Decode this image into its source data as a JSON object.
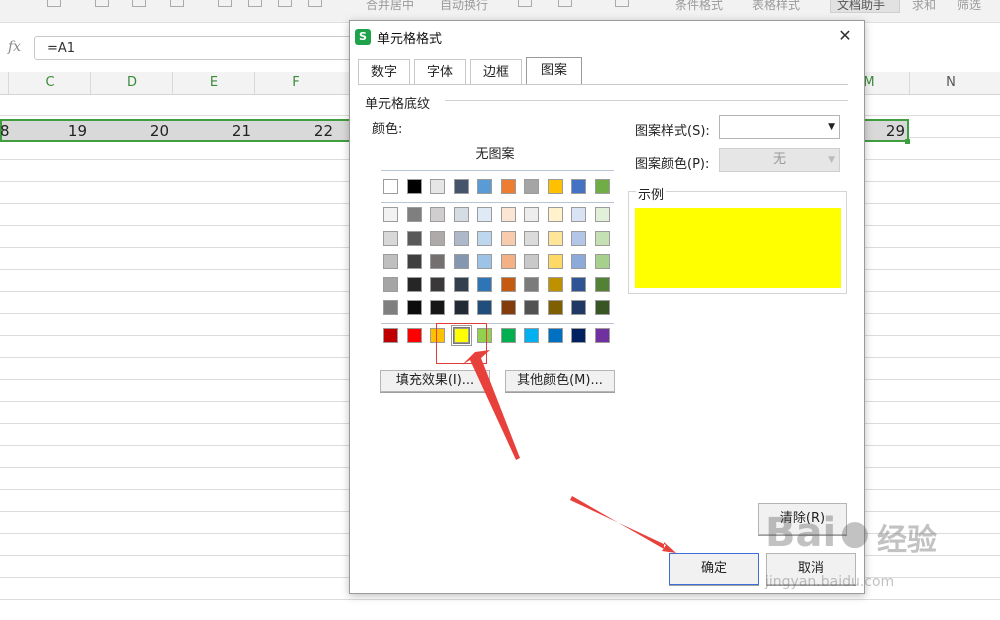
{
  "toolbar": {
    "items": [
      "合并居中",
      "自动换行",
      "条件格式",
      "表格样式",
      "文档助手",
      "求和",
      "筛选"
    ]
  },
  "formula": {
    "fx_label": "fx",
    "value": "=A1"
  },
  "sheet": {
    "columns": [
      "C",
      "D",
      "E",
      "F",
      "M",
      "N"
    ],
    "row_values": [
      "8",
      "19",
      "20",
      "21",
      "22",
      "29"
    ],
    "selection_color": "#3f9e3f"
  },
  "dialog": {
    "title": "单元格格式",
    "app_icon": "S",
    "close_glyph": "✕",
    "tabs": [
      "数字",
      "字体",
      "边框",
      "图案"
    ],
    "active_tab": "图案",
    "group_title": "单元格底纹",
    "color_label": "颜色:",
    "no_pattern": "无图案",
    "palette": {
      "row1": [
        "#ffffff",
        "#000000",
        "#e7e6e6",
        "#44546a",
        "#5b9bd5",
        "#ed7d31",
        "#a5a5a5",
        "#ffc000",
        "#4472c4",
        "#70ad47"
      ],
      "tints": [
        [
          "#f2f2f2",
          "#7f7f7f",
          "#d0cece",
          "#d6dce4",
          "#deebf6",
          "#fbe5d5",
          "#ededed",
          "#fff2cc",
          "#dae3f3",
          "#e2efd9"
        ],
        [
          "#d8d8d8",
          "#595959",
          "#aeaaaa",
          "#adb9ca",
          "#bdd7ee",
          "#f8cbad",
          "#dbdbdb",
          "#fee599",
          "#b4c6e7",
          "#c5e0b3"
        ],
        [
          "#bfbfbf",
          "#3f3f3f",
          "#757070",
          "#8496b0",
          "#9dc3e6",
          "#f4b183",
          "#c9c9c9",
          "#ffd965",
          "#8eaadb",
          "#a8d08d"
        ],
        [
          "#a5a5a5",
          "#262626",
          "#3a3838",
          "#323f4f",
          "#2e75b5",
          "#c55a11",
          "#7b7b7b",
          "#bf9000",
          "#2f5496",
          "#538135"
        ],
        [
          "#7f7f7f",
          "#0c0c0c",
          "#171616",
          "#222a35",
          "#1e4e79",
          "#833c0b",
          "#525252",
          "#7f6000",
          "#1f3864",
          "#375623"
        ]
      ],
      "standard": [
        "#c00000",
        "#ff0000",
        "#ffc000",
        "#ffff00",
        "#92d050",
        "#00b050",
        "#00b0f0",
        "#0070c0",
        "#002060",
        "#7030a0"
      ],
      "selected_index": 3
    },
    "fill_effects_button": "填充效果(I)...",
    "more_colors_button": "其他颜色(M)...",
    "pattern_style_label": "图案样式(S):",
    "pattern_style_value": "",
    "pattern_color_label": "图案颜色(P):",
    "pattern_color_value": "无",
    "sample_label": "示例",
    "sample_color": "#ffff00",
    "clear_button": "清除(R)",
    "ok_button": "确定",
    "cancel_button": "取消"
  },
  "watermark": {
    "brand": "Bai",
    "brand_cn": "经验",
    "url": "jingyan.baidu.com"
  },
  "annotation_color": "#e8413c"
}
